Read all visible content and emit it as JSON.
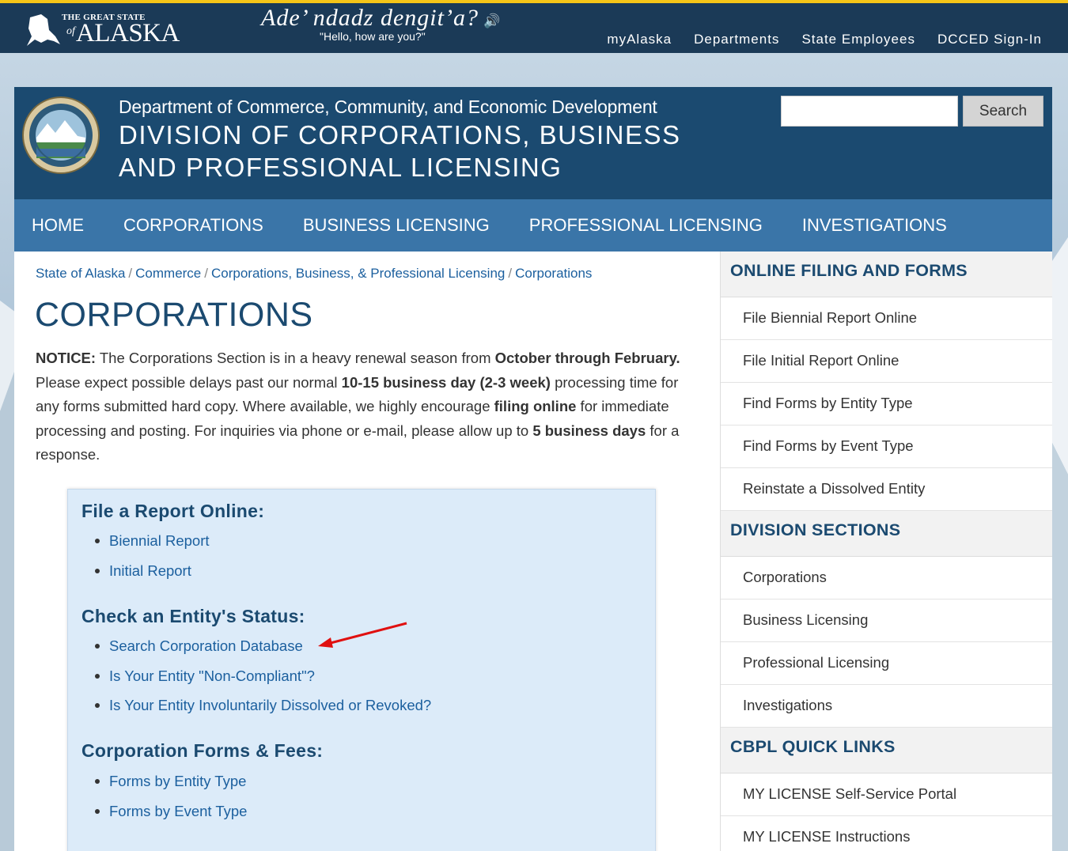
{
  "topbar": {
    "logo_small": "THE GREAT STATE",
    "logo_of": "of",
    "logo_big": "ALASKA",
    "greeting_native": "Ade’ ndadz dengit’a?",
    "greeting_english": "\"Hello, how are you?\"",
    "nav": [
      "myAlaska",
      "Departments",
      "State Employees",
      "DCCED Sign-In"
    ],
    "accent_color": "#f5c518"
  },
  "header": {
    "department": "Department of Commerce, Community, and Economic Development",
    "division_line1": "DIVISION OF CORPORATIONS, BUSINESS",
    "division_line2": "AND PROFESSIONAL LICENSING",
    "search_value": "",
    "search_button": "Search"
  },
  "main_nav": [
    "HOME",
    "CORPORATIONS",
    "BUSINESS LICENSING",
    "PROFESSIONAL LICENSING",
    "INVESTIGATIONS"
  ],
  "breadcrumb": [
    "State of Alaska",
    "Commerce",
    "Corporations, Business, & Professional Licensing",
    "Corporations"
  ],
  "page_title": "CORPORATIONS",
  "notice": {
    "label": "NOTICE:",
    "t1": " The Corporations Section is in a heavy renewal season from ",
    "b1": "October through February.",
    "t2": " Please expect possible delays past our normal ",
    "b2": "10-15 business day (2-3 week)",
    "t3": " processing time for any forms submitted hard copy. Where available, we highly encourage ",
    "b3": "filing online",
    "t4": " for immediate processing and posting. For inquiries via phone or e-mail, please allow up to ",
    "b4": "5 business days",
    "t5": " for a response."
  },
  "infobox": {
    "sections": [
      {
        "title": "File a Report Online:",
        "links": [
          "Biennial Report",
          "Initial Report"
        ]
      },
      {
        "title": "Check an Entity's Status:",
        "links": [
          "Search Corporation Database",
          "Is Your Entity \"Non-Compliant\"?",
          "Is Your Entity Involuntarily Dissolved or Revoked?"
        ]
      },
      {
        "title": "Corporation Forms & Fees:",
        "links": [
          "Forms by Entity Type",
          "Forms by Event Type"
        ]
      }
    ]
  },
  "sidebar": {
    "groups": [
      {
        "title": "ONLINE FILING AND FORMS",
        "items": [
          "File Biennial Report Online",
          "File Initial Report Online",
          "Find Forms by Entity Type",
          "Find Forms by Event Type",
          "Reinstate a Dissolved Entity"
        ]
      },
      {
        "title": "DIVISION SECTIONS",
        "items": [
          "Corporations",
          "Business Licensing",
          "Professional Licensing",
          "Investigations"
        ]
      },
      {
        "title": "CBPL QUICK LINKS",
        "items": [
          "MY LICENSE Self-Service Portal",
          "MY LICENSE Instructions"
        ]
      }
    ]
  },
  "colors": {
    "topbar": "#1b3a57",
    "header": "#1b4a70",
    "nav": "#3a75a8",
    "link": "#1b5f9e",
    "infobox": "#dcebf9",
    "arrow": "#e01010"
  }
}
